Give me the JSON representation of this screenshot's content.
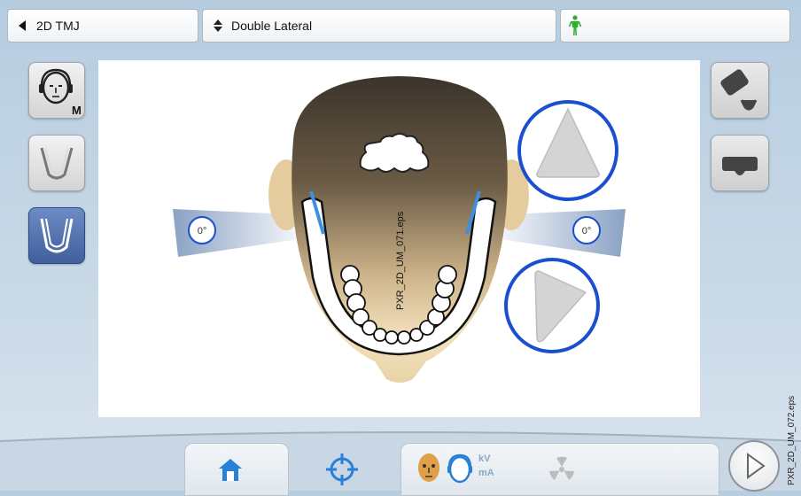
{
  "topbar": {
    "program": "2D TMJ",
    "projection": "Double Lateral",
    "patient_icon": "patient-standing-icon"
  },
  "left_tools": [
    "head-positioning-icon",
    "jaw-outline-icon",
    "jaw-selected-icon"
  ],
  "left_tools_badge": "M",
  "right_tools": [
    "bite-block-icon",
    "chin-rest-icon"
  ],
  "canvas": {
    "figure_label": "PXR_2D_UM_071.eps",
    "left_angle": "0°",
    "right_angle": "0°",
    "up_arrow": "triangle-up-icon",
    "right_arrow": "triangle-right-icon"
  },
  "bottom_tabs": [
    "home-icon",
    "target-icon",
    "patient-settings-icon",
    "radiation-icon"
  ],
  "bottom_kv_label": "kV",
  "bottom_ma_label": "mA",
  "play_icon": "play-icon",
  "side_label": "PXR_2D_UM_072.eps",
  "colors": {
    "accent": "#1b4fd0",
    "active_button": "#4a6aa8",
    "guide_line": "#3d8fe0"
  }
}
